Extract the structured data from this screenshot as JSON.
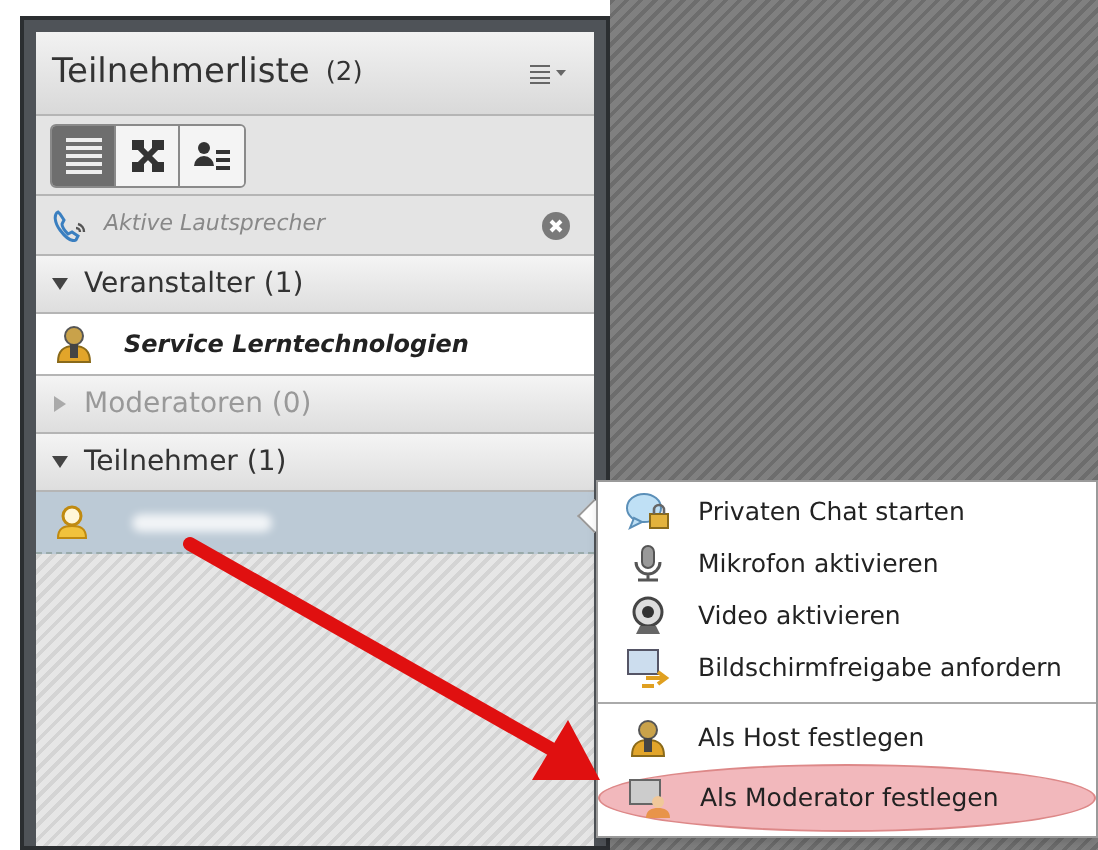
{
  "panel": {
    "title": "Teilnehmerliste",
    "count": "(2)",
    "view_buttons": [
      {
        "kind": "list",
        "selected": true
      },
      {
        "kind": "grid",
        "selected": false
      },
      {
        "kind": "detail",
        "selected": false
      }
    ],
    "filter": {
      "label": "Aktive Lautsprecher"
    },
    "groups": [
      {
        "label": "Veranstalter (1)",
        "expanded": true,
        "members": [
          {
            "kind": "host",
            "name": "Service Lerntechnologien",
            "selected": false
          }
        ]
      },
      {
        "label": "Moderatoren (0)",
        "expanded": false
      },
      {
        "label": "Teilnehmer (1)",
        "expanded": true,
        "members": [
          {
            "kind": "participant",
            "selected": true
          }
        ]
      }
    ]
  },
  "context_menu": {
    "sections": [
      [
        {
          "kind": "chat",
          "label": "Privaten Chat starten",
          "highlighted": false
        },
        {
          "kind": "microphone",
          "label": "Mikrofon aktivieren",
          "highlighted": false
        },
        {
          "kind": "webcam",
          "label": "Video aktivieren",
          "highlighted": false
        },
        {
          "kind": "screen",
          "label": "Bildschirmfreigabe anfordern",
          "highlighted": false
        }
      ],
      [
        {
          "kind": "host",
          "label": "Als Host festlegen",
          "highlighted": false
        },
        {
          "kind": "presenter",
          "label": "Als Moderator festlegen",
          "highlighted": true
        }
      ]
    ]
  }
}
